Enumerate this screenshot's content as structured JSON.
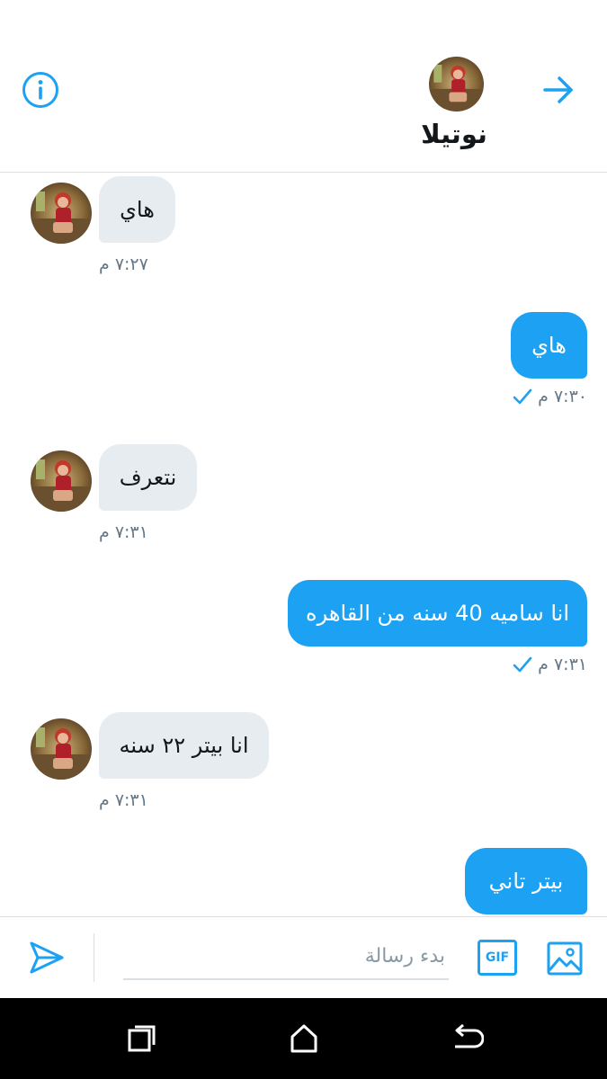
{
  "header": {
    "contact_name": "نوتيلا",
    "info_icon": "info-icon",
    "back_icon": "arrow-right-icon"
  },
  "messages": [
    {
      "direction": "in",
      "text": "هاي",
      "time": "٧:٢٧ م"
    },
    {
      "direction": "out",
      "text": "هاي",
      "time": "٧:٣٠ م",
      "status_icon": "check-icon"
    },
    {
      "direction": "in",
      "text": "نتعرف",
      "time": "٧:٣١ م"
    },
    {
      "direction": "out",
      "text": "انا ساميه 40 سنه من القاهره",
      "time": "٧:٣١ م",
      "status_icon": "check-icon"
    },
    {
      "direction": "in",
      "text": "انا بيتر ٢٢ سنه",
      "time": "٧:٣١ م"
    },
    {
      "direction": "out",
      "text": "بيتر تاني"
    }
  ],
  "composer": {
    "placeholder": "بدء رسالة",
    "value": "",
    "gif_label": "GIF",
    "send_icon": "send-icon",
    "image_icon": "image-icon"
  },
  "navbar": {
    "recents_icon": "recents-icon",
    "home_icon": "home-icon",
    "back_icon": "back-icon"
  },
  "colors": {
    "accent": "#1da1f2",
    "incoming_bubble": "#e6ecf0",
    "timestamp": "#657786",
    "divider": "#d9dfe3",
    "navbar": "#000000"
  }
}
